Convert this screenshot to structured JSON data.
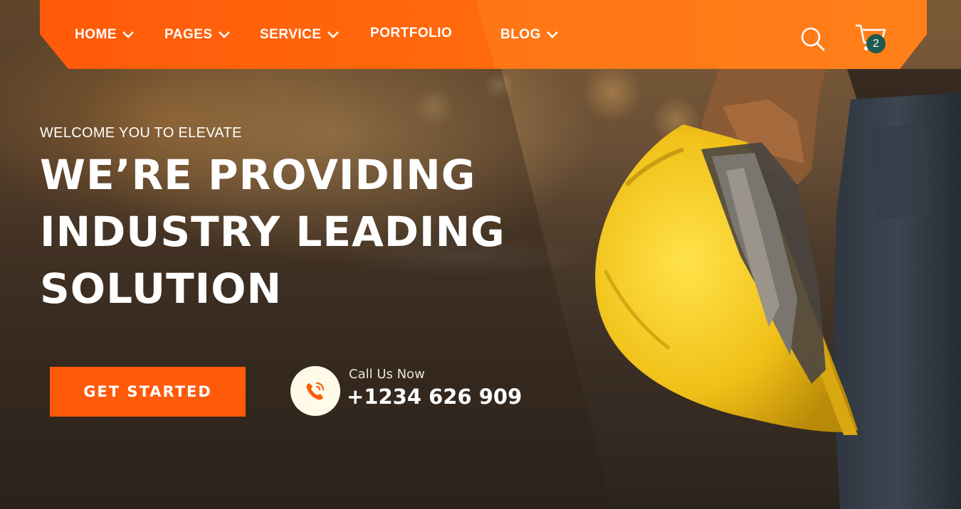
{
  "nav": {
    "items": [
      {
        "label": "HOME",
        "has_dropdown": true
      },
      {
        "label": "PAGES",
        "has_dropdown": true
      },
      {
        "label": "SERVICE",
        "has_dropdown": true
      },
      {
        "label": "PORTFOLIO",
        "has_dropdown": false
      },
      {
        "label": "BLOG",
        "has_dropdown": true
      }
    ],
    "search_icon": "search-icon",
    "cart_icon": "cart-icon",
    "cart_count": "2"
  },
  "hero": {
    "eyebrow": "WELCOME YOU TO ELEVATE",
    "headline_lines": [
      "WE’RE PROVIDING",
      "INDUSTRY LEADING",
      "SOLUTION"
    ],
    "cta_label": "GET  STARTED",
    "call_label": "Call Us Now",
    "call_number": "+1234 626 909",
    "phone_icon": "phone-icon"
  },
  "colors": {
    "accent": "#ff5a0a",
    "badge": "#1f5a4f",
    "helmet": "#f2c21a"
  }
}
